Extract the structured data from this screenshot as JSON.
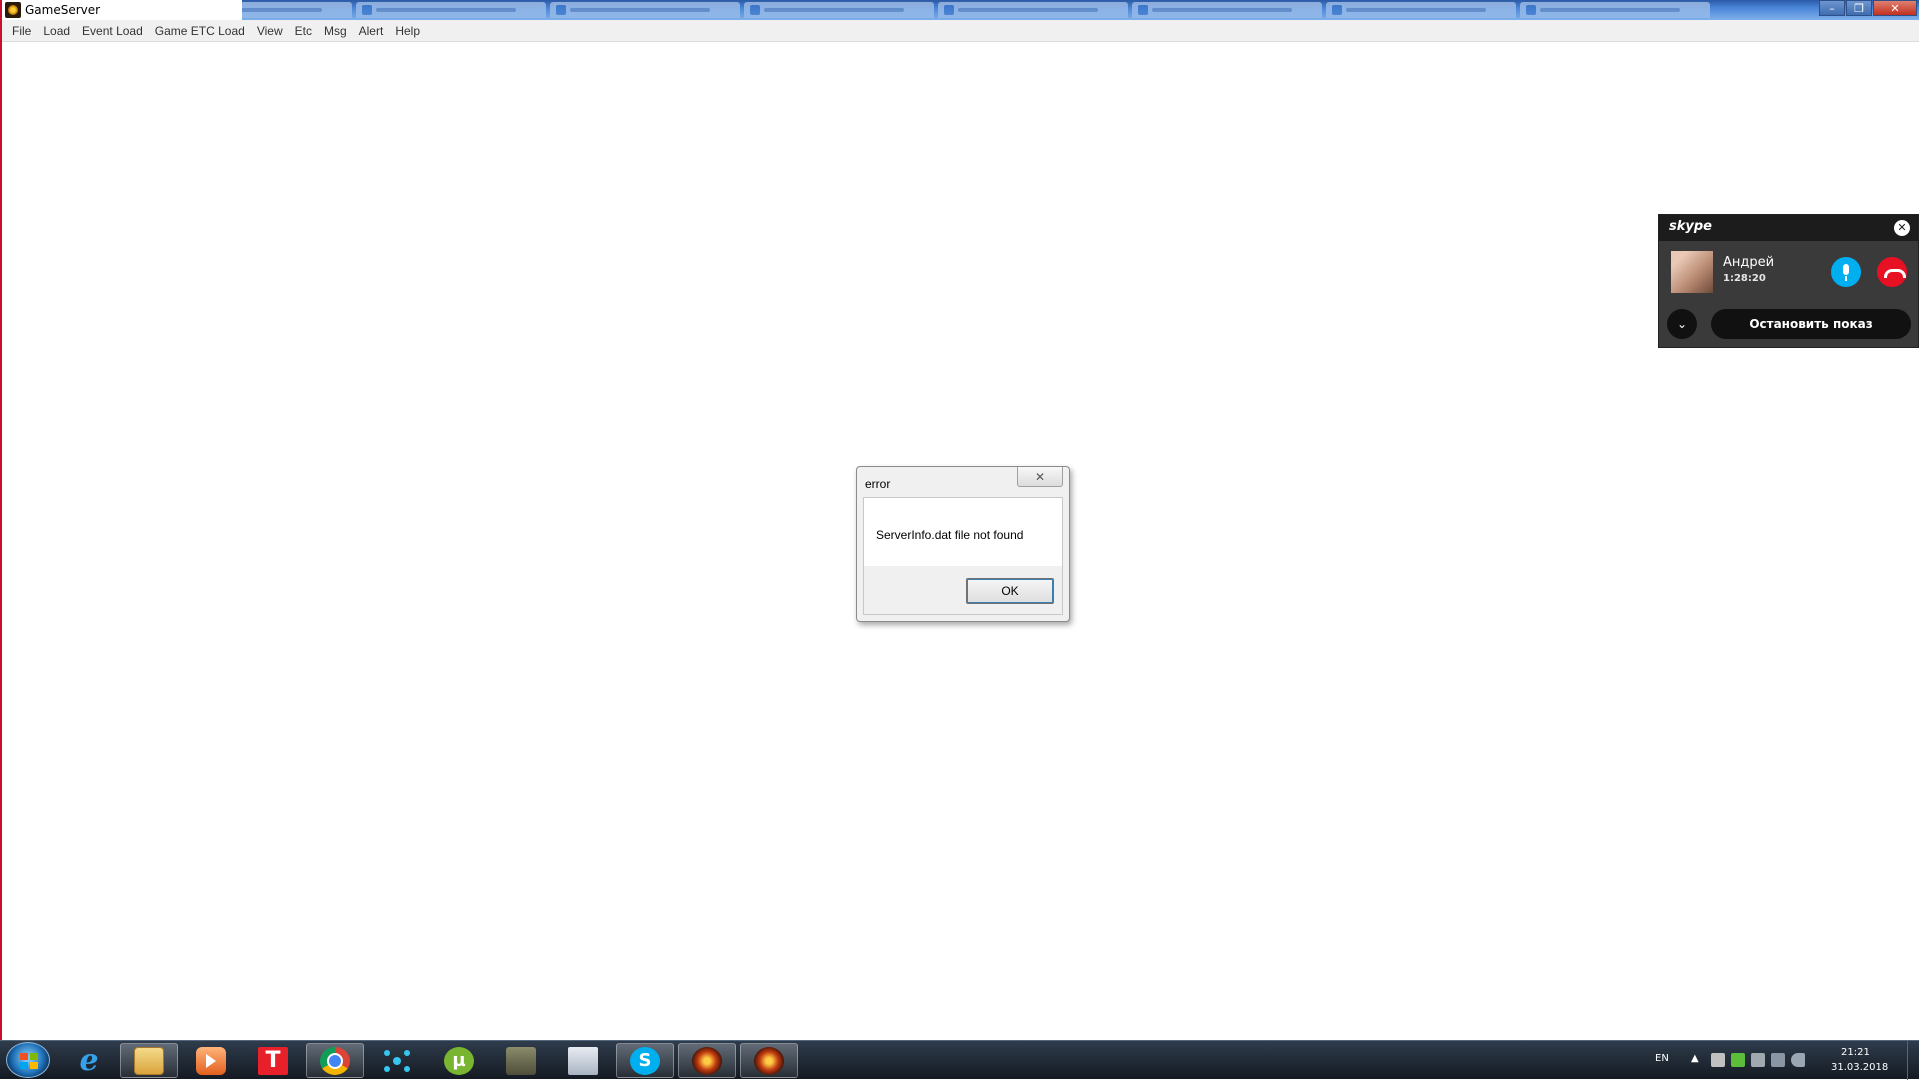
{
  "window": {
    "title": "GameServer",
    "controls": {
      "minimize": "–",
      "maximize": "❐",
      "close": "✕"
    }
  },
  "menu": {
    "items": [
      "File",
      "Load",
      "Event Load",
      "Game ETC Load",
      "View",
      "Etc",
      "Msg",
      "Alert",
      "Help"
    ]
  },
  "skype": {
    "logo": "skype",
    "close_icon": "✕",
    "caller_name": "Андрей",
    "call_duration": "1:28:20",
    "expand_icon": "⌄",
    "stop_sharing_label": "Остановить показ",
    "colors": {
      "mic": "#00aff0",
      "hangup": "#e81123",
      "panel": "#3a3a3a"
    }
  },
  "dialog": {
    "title": "error",
    "close_icon": "✕",
    "message": "ServerInfo.dat file not found",
    "ok_label": "OK"
  },
  "taskbar": {
    "apps": [
      {
        "name": "internet-explorer",
        "glyph": "e"
      },
      {
        "name": "file-explorer",
        "glyph": ""
      },
      {
        "name": "media-player",
        "glyph": ""
      },
      {
        "name": "t-app",
        "glyph": "T"
      },
      {
        "name": "chrome",
        "glyph": ""
      },
      {
        "name": "network-app",
        "glyph": ""
      },
      {
        "name": "utorrent",
        "glyph": "µ"
      },
      {
        "name": "tank-game",
        "glyph": ""
      },
      {
        "name": "list-app",
        "glyph": ""
      },
      {
        "name": "skype",
        "glyph": "S"
      },
      {
        "name": "game-server-1",
        "glyph": ""
      },
      {
        "name": "game-server-2",
        "glyph": ""
      }
    ],
    "tray": {
      "language": "EN",
      "arrow": "▲",
      "time": "21:21",
      "date": "31.03.2018"
    }
  }
}
